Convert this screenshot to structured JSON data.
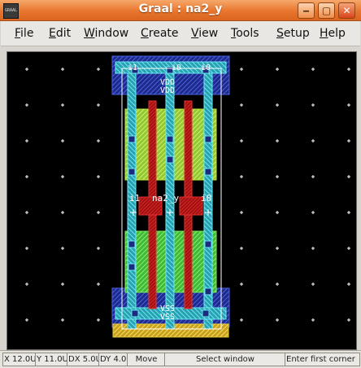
{
  "window": {
    "title": "Graal : na2_y",
    "icon_name": "graal-app-icon",
    "controls": [
      {
        "name": "minimize-button",
        "glyph": "‒"
      },
      {
        "name": "maximize-button",
        "glyph": "▢"
      },
      {
        "name": "close-button",
        "glyph": "✕"
      }
    ]
  },
  "menu": {
    "items": [
      {
        "label": "File",
        "key": "F",
        "rest": "ile"
      },
      {
        "label": "Edit",
        "key": "E",
        "rest": "dit"
      },
      {
        "label": "Window",
        "key": "W",
        "rest": "indow"
      },
      {
        "label": "Create",
        "key": "C",
        "rest": "reate"
      },
      {
        "label": "View",
        "key": "V",
        "rest": "iew"
      },
      {
        "label": "Tools",
        "key": "T",
        "rest": "ools"
      },
      {
        "label": "Setup",
        "key": "S",
        "rest": "etup"
      },
      {
        "label": "Help",
        "key": "H",
        "rest": "elp"
      }
    ]
  },
  "layout_canvas": {
    "background": "#000000",
    "cell_name": "na2_y",
    "labels": {
      "input_i1": "i1",
      "input_i0_top": "i0",
      "input_i0_mid": "i0",
      "output_top": "i0",
      "vdd_1": "VDD",
      "vdd_2": "VDD",
      "vss_1": "VSS",
      "vss_2": "VSS",
      "cell_name": "na2_y",
      "i1_mid": "i1"
    },
    "colors": {
      "grid_dot": "#ffffff",
      "nwell": "#2e3fbf",
      "pdiff": "#b8e23a",
      "ndiff": "#5ad35a",
      "poly": "#c81a1a",
      "metal1": "#38c8d8",
      "metal_rail": "#5a7ee8",
      "ptie": "#e8c838",
      "outline": "#ffffff"
    }
  },
  "status": {
    "x": "X 12.0U",
    "y": "Y 11.0U",
    "dx": "DX 5.0U",
    "dy": "DY 4.0U",
    "mode": "Move",
    "action": "Select window",
    "prompt": "Enter first corner"
  }
}
